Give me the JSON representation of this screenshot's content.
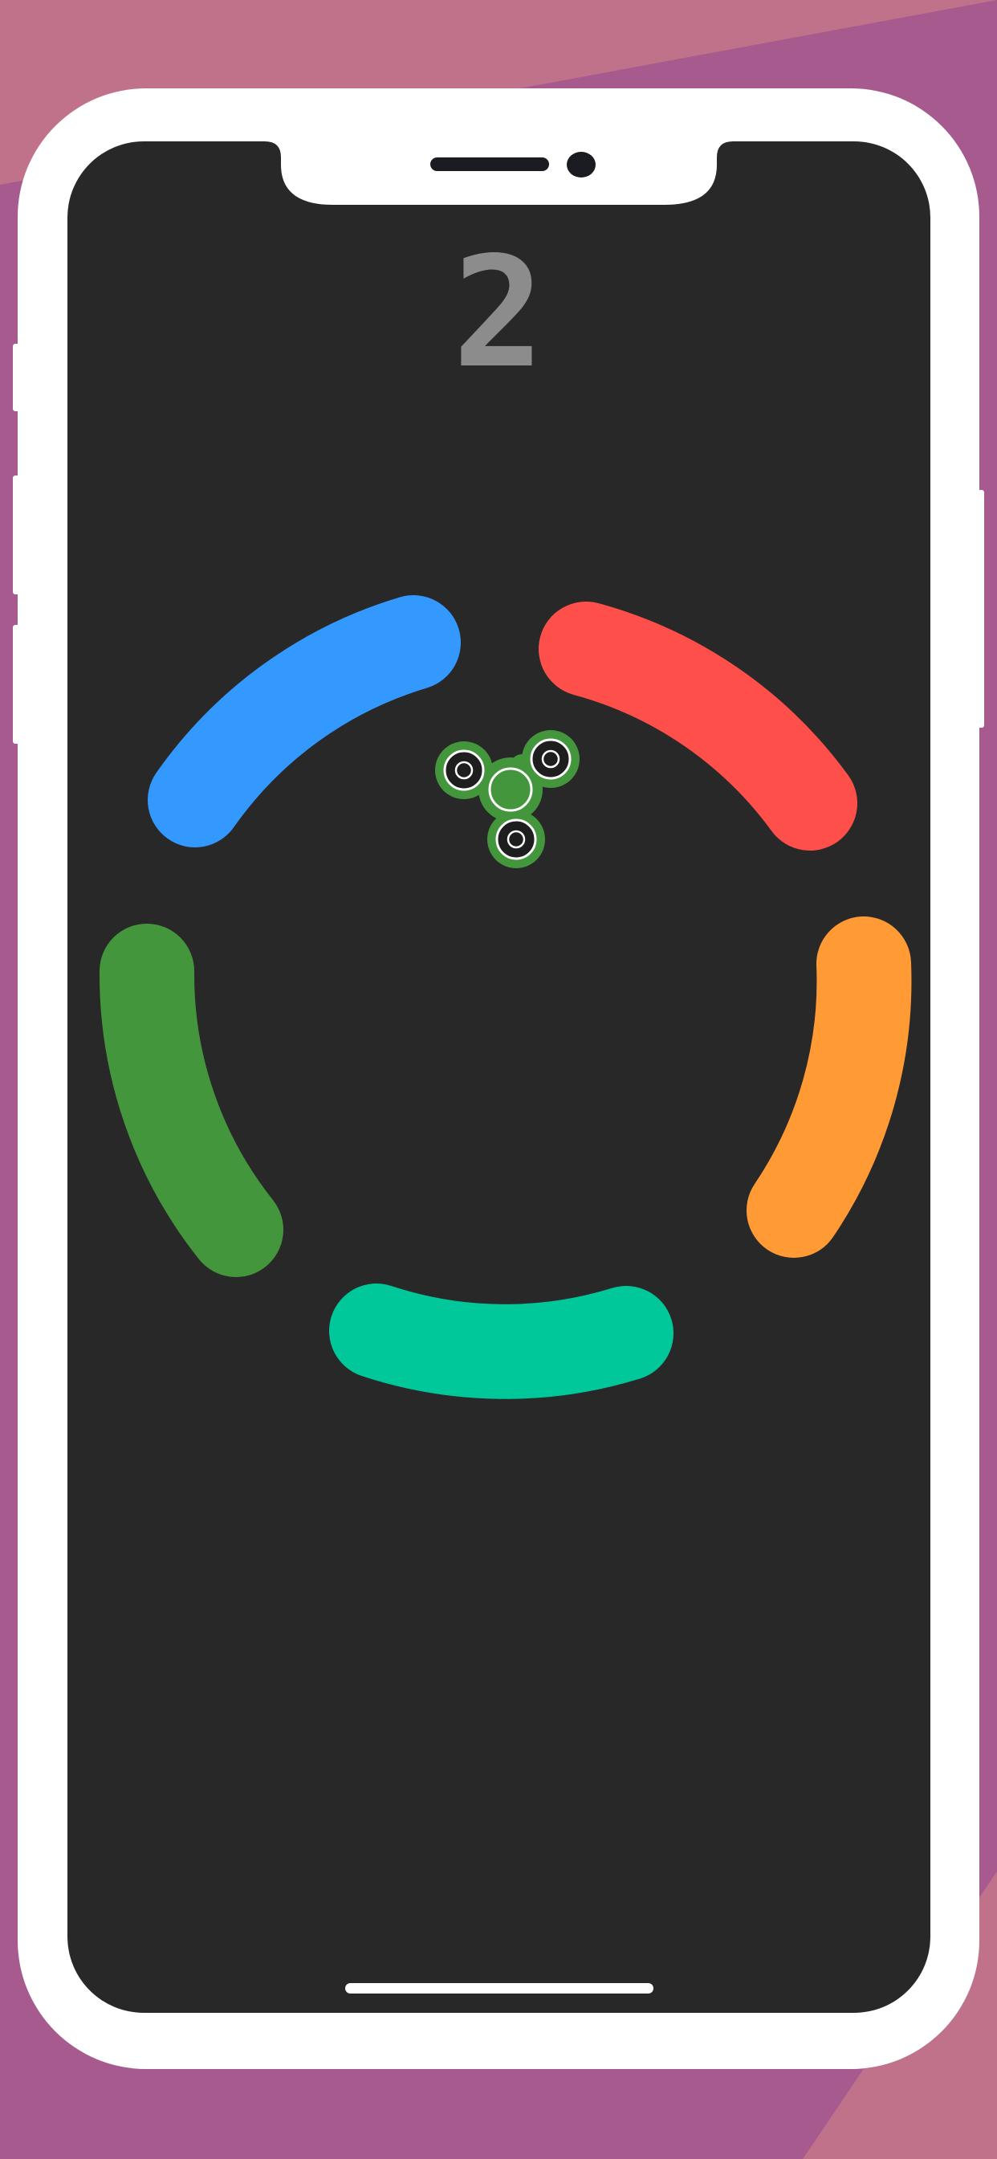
{
  "background": {
    "base_color": "#a65a8d",
    "stripe_color": "#c0728a"
  },
  "device": {
    "frame_color": "#ffffff",
    "screen_color": "#282828",
    "notch_color": "#ffffff",
    "speaker_color": "#1b1b22",
    "home_indicator_color": "#ffffff"
  },
  "game": {
    "score": "2",
    "score_color": "#8c8c8c",
    "ring_segments": [
      {
        "name": "ring-segment-blue",
        "color": "#3399ff"
      },
      {
        "name": "ring-segment-red",
        "color": "#ff4f4a"
      },
      {
        "name": "ring-segment-orange",
        "color": "#ff9a35"
      },
      {
        "name": "ring-segment-teal",
        "color": "#00c89a"
      },
      {
        "name": "ring-segment-green",
        "color": "#43963b"
      }
    ],
    "spinner": {
      "icon": "fidget-spinner-icon",
      "color": "#43963b"
    }
  }
}
